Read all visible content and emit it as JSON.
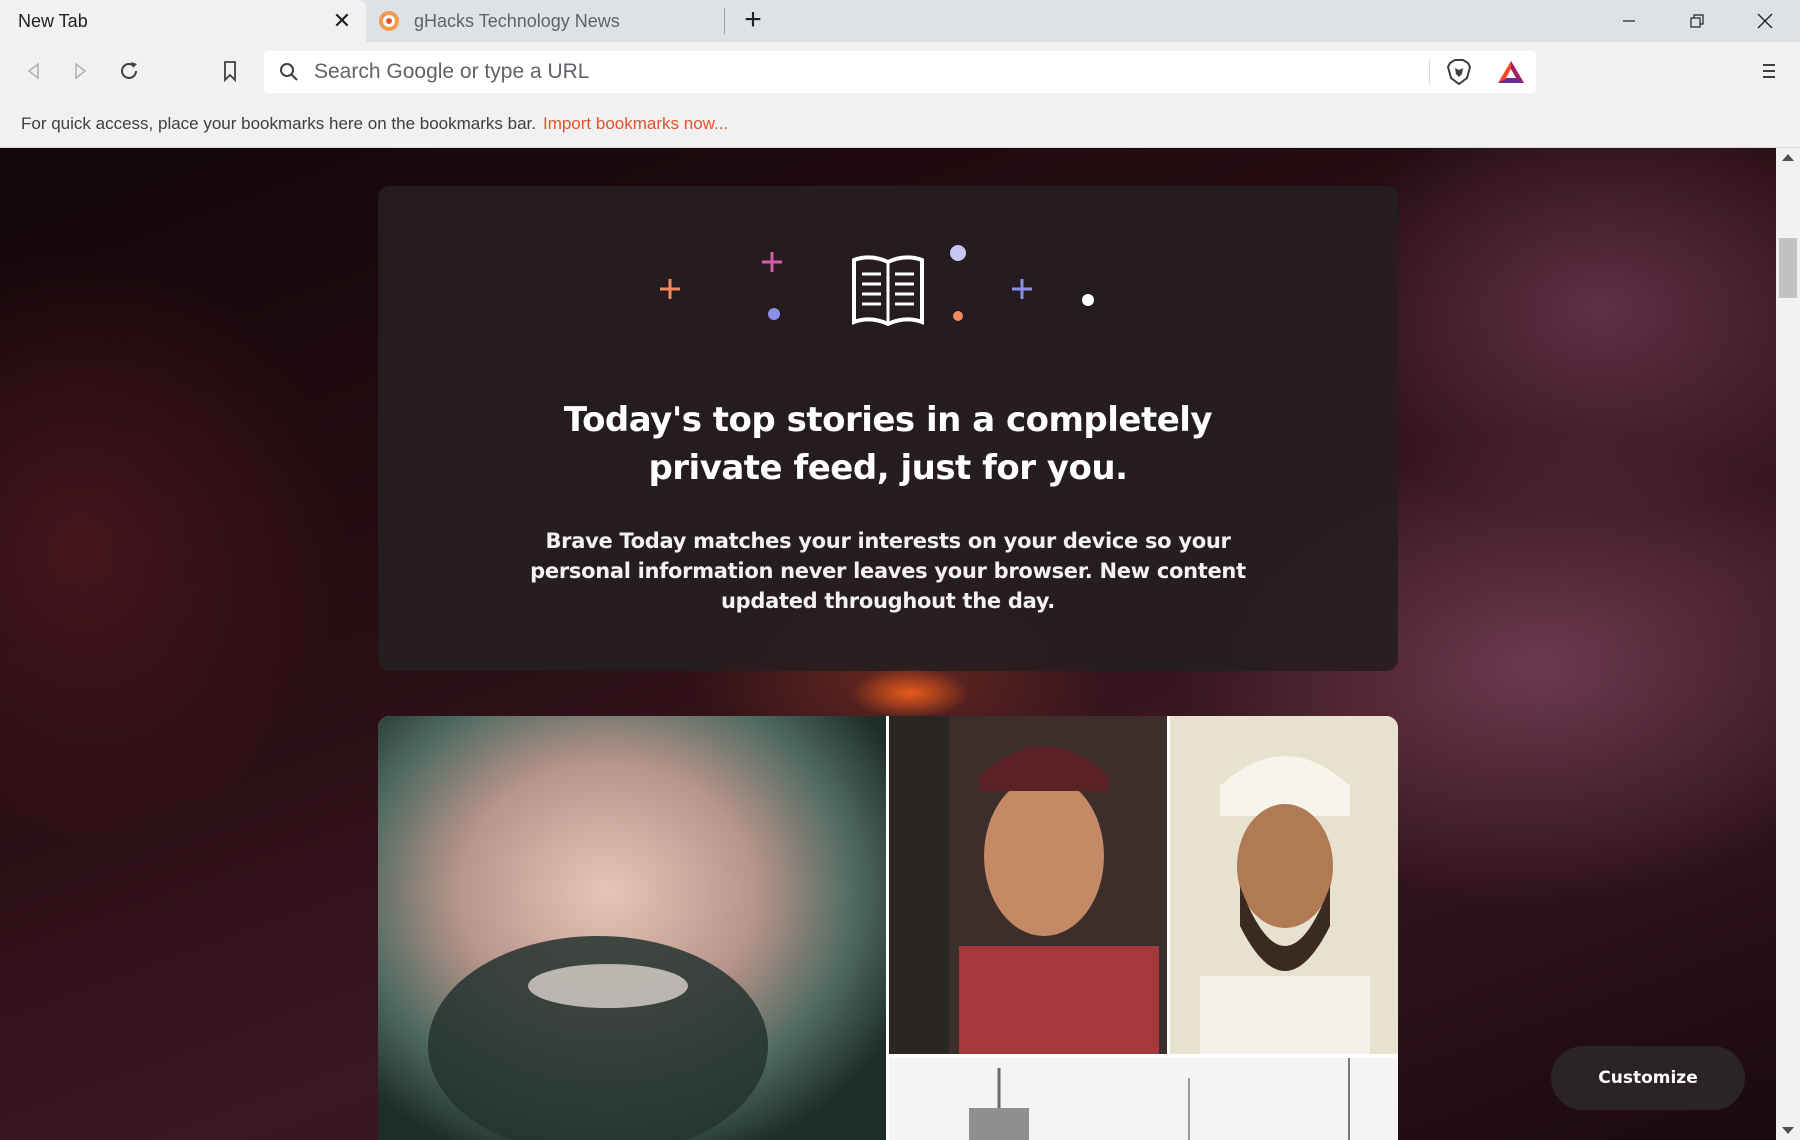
{
  "tabs": [
    {
      "title": "New Tab",
      "active": true
    },
    {
      "title": "gHacks Technology News",
      "active": false
    }
  ],
  "omnibox": {
    "placeholder": "Search Google or type a URL",
    "value": ""
  },
  "bookmarks_bar": {
    "message": "For quick access, place your bookmarks here on the bookmarks bar.",
    "link": "Import bookmarks now..."
  },
  "brave_today": {
    "heading": "Today's top stories in a completely private feed, just for you.",
    "description": "Brave Today matches your interests on your device so your personal information never leaves your browser. New content updated throughout the day."
  },
  "customize_button": "Customize",
  "colors": {
    "accent_link": "#e0532e",
    "card_bg": "#261e20",
    "plus_orange": "#f08a5d",
    "plus_pink": "#d45ba8",
    "plus_blue": "#8a8fe8"
  }
}
